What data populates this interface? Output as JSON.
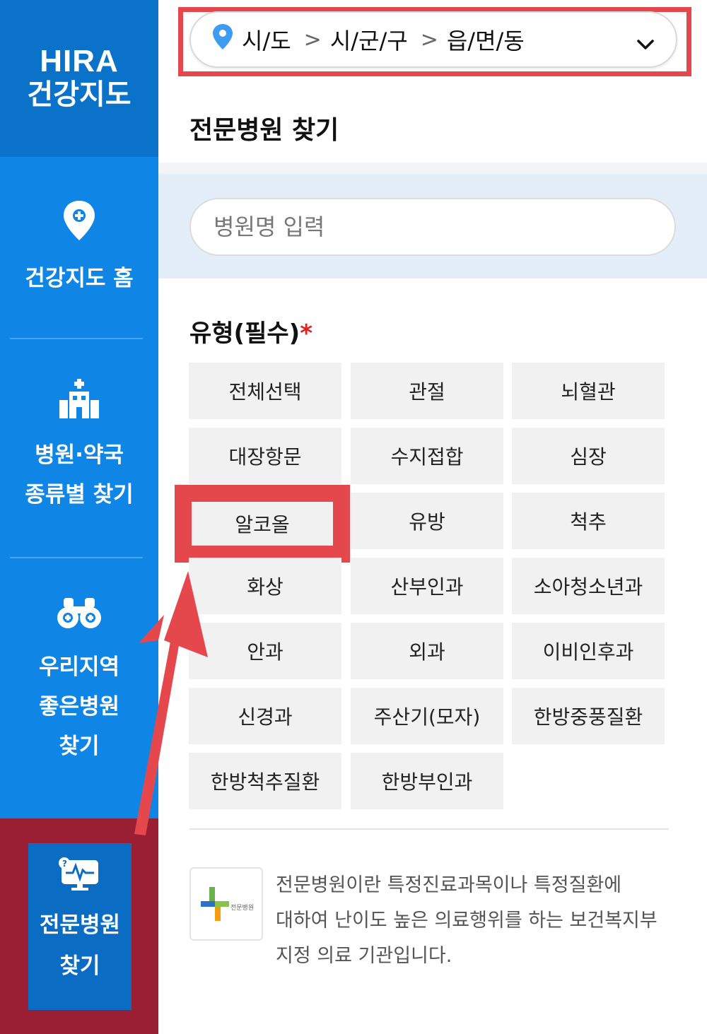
{
  "brand": {
    "top": "HIRA",
    "bottom": "건강지도"
  },
  "sidebar": {
    "home": {
      "line1": "건강지도 홈"
    },
    "types": {
      "line1": "병원·약국",
      "line2": "종류별 찾기"
    },
    "area": {
      "line1": "우리지역",
      "line2": "좋은병원",
      "line3": "찾기"
    },
    "specialty": {
      "line1": "전문병원",
      "line2": "찾기"
    }
  },
  "location": {
    "level1": "시/도",
    "level2": "시/군/구",
    "level3": "읍/면/동"
  },
  "page_title": "전문병원 찾기",
  "search": {
    "placeholder": "병원명 입력"
  },
  "type_section": {
    "title": "유형(필수)",
    "required_mark": "*"
  },
  "types": [
    "전체선택",
    "관절",
    "뇌혈관",
    "대장항문",
    "수지접합",
    "심장",
    "알코올",
    "유방",
    "척추",
    "화상",
    "산부인과",
    "소아청소년과",
    "안과",
    "외과",
    "이비인후과",
    "신경과",
    "주산기(모자)",
    "한방중풍질환",
    "한방척추질환",
    "한방부인과"
  ],
  "info": {
    "logo_text": "전문병원",
    "line1": "전문병원이란 특정진료과목이나 특정질환에",
    "line2": "대하여 난이도 높은 의료행위를 하는 보건복지부",
    "line3": "지정 의료 기관입니다."
  },
  "colors": {
    "sidebar": "#0f86e5",
    "highlight": "#e4484d",
    "active_frame": "#9b1f33"
  }
}
